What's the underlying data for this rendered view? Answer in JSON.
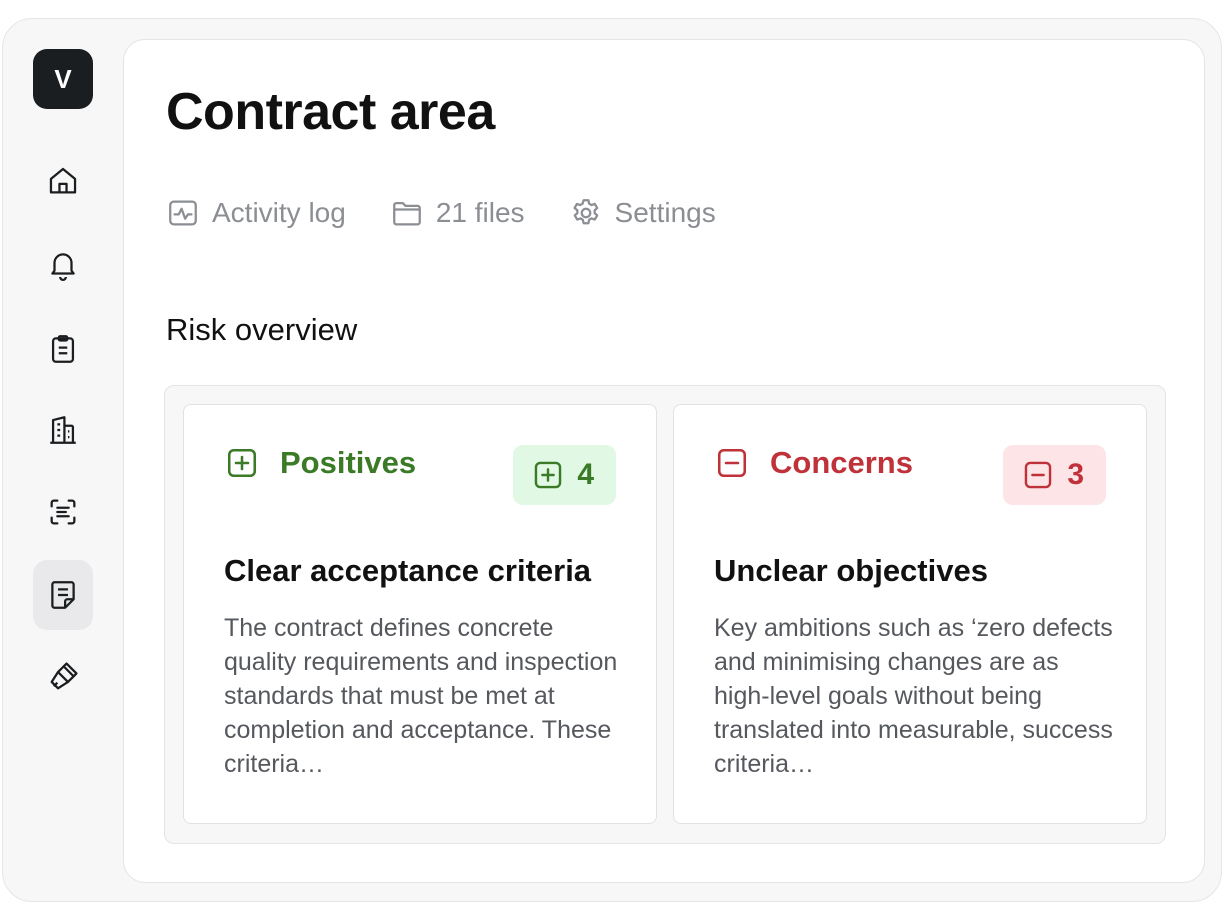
{
  "sidebar": {
    "logo_letter": "V",
    "items": [
      {
        "icon": "home-icon"
      },
      {
        "icon": "bell-icon"
      },
      {
        "icon": "clipboard-icon"
      },
      {
        "icon": "building-icon"
      },
      {
        "icon": "scan-text-icon"
      },
      {
        "icon": "note-icon",
        "active": true
      },
      {
        "icon": "brush-icon"
      }
    ]
  },
  "main": {
    "title": "Contract area",
    "meta": {
      "activity": "Activity log",
      "files": "21 files",
      "settings": "Settings"
    },
    "section_title": "Risk overview",
    "positives": {
      "label": "Positives",
      "count": "4",
      "item_title": "Clear acceptance criteria",
      "item_desc": "The contract defines concrete quality requirements and inspection standards that must be met at completion and acceptance. These criteria…"
    },
    "concerns": {
      "label": "Concerns",
      "count": "3",
      "item_title": "Unclear objectives",
      "item_desc": "Key ambitions such as ‘zero defects and minimising changes are as high-level goals without being translated into measurable, success criteria…"
    }
  },
  "colors": {
    "positive": "#3b7a26",
    "positive_bg": "#e0f8e4",
    "concern": "#c0323a",
    "concern_bg": "#fde4e6",
    "logo_bg": "#1b1e20"
  }
}
